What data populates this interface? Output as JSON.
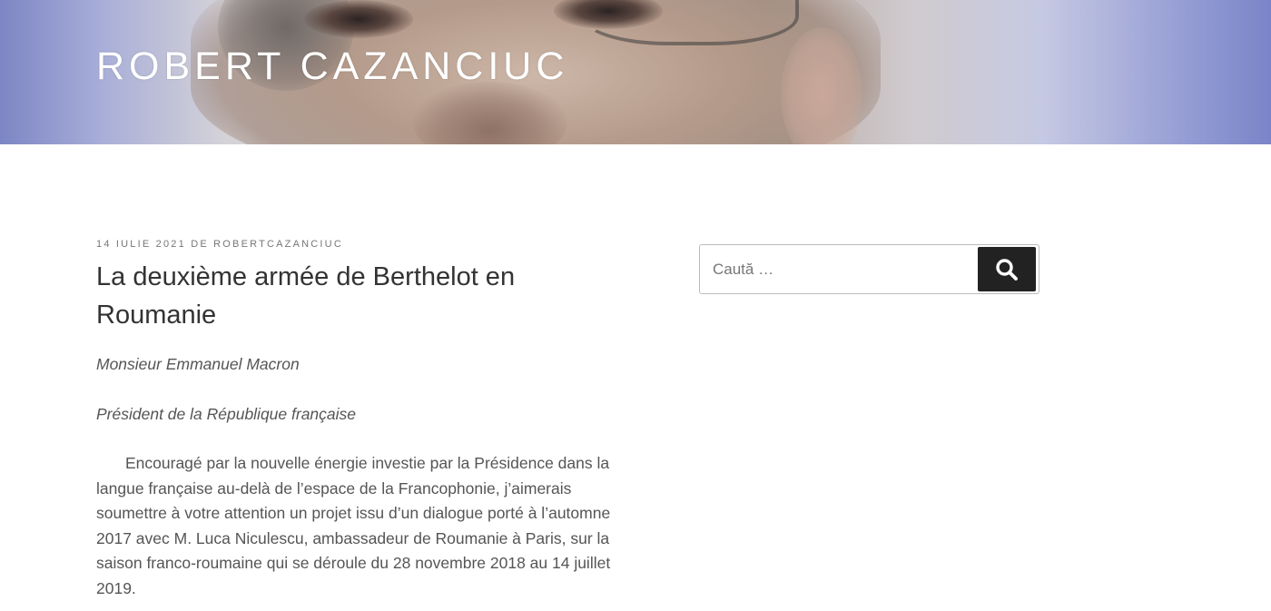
{
  "site": {
    "title": "ROBERT CAZANCIUC"
  },
  "post": {
    "date": "14 IULIE 2021",
    "by_label": "DE",
    "author": "ROBERTCAZANCIUC",
    "title": "La deuxième armée de Berthelot en Roumanie",
    "salutation_1": "Monsieur Emmanuel Macron",
    "salutation_2": "Président de la République française",
    "paragraph_1": "Encouragé par la nouvelle énergie investie par la Présidence dans la langue française  au-delà de l’espace de la Francophonie, j’aimerais soumettre à votre attention un projet issu d’un dialogue porté à l’automne 2017 avec M. Luca Niculescu, ambassadeur de Roumanie à Paris, sur la saison franco-roumaine qui se déroule du 28 novembre 2018 au 14 juillet 2019."
  },
  "sidebar": {
    "search": {
      "placeholder": "Caută …",
      "value": "",
      "icon": "search-icon"
    }
  },
  "colors": {
    "button_bg": "#222222",
    "title_text": "#ffffff",
    "body_text": "#555555"
  }
}
